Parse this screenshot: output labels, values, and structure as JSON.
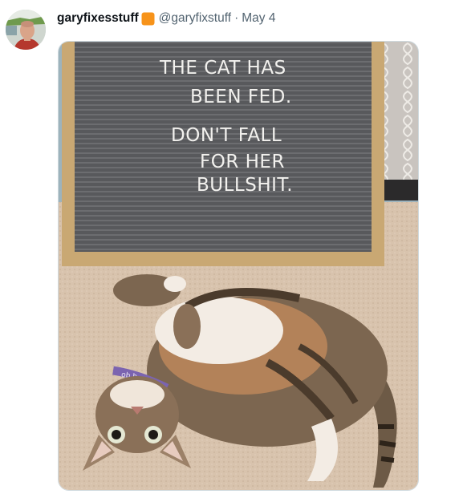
{
  "tweet": {
    "display_name": "garyfixesstuff",
    "handle": "@garyfixstuff",
    "separator": "·",
    "date": "May 4",
    "badge_color": "#f7931a"
  },
  "photo": {
    "letterboard_lines": [
      "THE CAT HAS",
      "BEEN FED.",
      "DON'T FALL",
      "FOR HER",
      "BULLSHIT."
    ],
    "collar_text": "ob b"
  },
  "icons": {
    "badge": "verified-badge-icon"
  }
}
